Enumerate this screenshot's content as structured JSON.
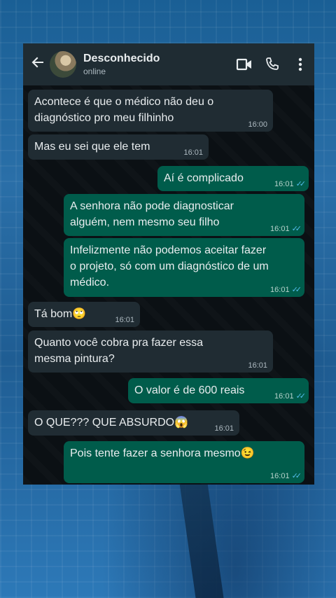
{
  "header": {
    "contact_name": "Desconhecido",
    "status": "online",
    "icons": [
      "back-arrow-icon",
      "avatar",
      "video-call-icon",
      "phone-call-icon",
      "more-options-icon"
    ]
  },
  "messages": [
    {
      "dir": "in",
      "text": "Acontece é que o médico não deu o diagnóstico pro meu filhinho",
      "time": "16:00"
    },
    {
      "dir": "in",
      "text": "Mas eu sei que ele tem",
      "time": "16:01"
    },
    {
      "dir": "out",
      "text": "Aí é complicado",
      "time": "16:01",
      "read": true
    },
    {
      "dir": "out",
      "text": "A senhora não pode diagnosticar alguém, nem mesmo seu filho",
      "time": "16:01",
      "read": true
    },
    {
      "dir": "out",
      "text": "Infelizmente não podemos aceitar fazer o projeto, só com um diagnóstico de um médico.",
      "time": "16:01",
      "read": true
    },
    {
      "dir": "in",
      "text": "Tá bom",
      "emoji": "🙄",
      "time": "16:01"
    },
    {
      "dir": "in",
      "text": "Quanto você cobra pra fazer essa mesma pintura?",
      "time": "16:01"
    },
    {
      "dir": "out",
      "text": "O valor é de 600 reais",
      "time": "16:01",
      "read": true
    },
    {
      "dir": "in",
      "text": "O QUE??? QUE ABSURDO",
      "emoji": "😱",
      "time": "16:01"
    },
    {
      "dir": "out",
      "text": "Pois tente fazer a senhora mesmo",
      "emoji": "😉",
      "time": "16:01",
      "read": true
    }
  ],
  "colors": {
    "header": "#1f2c33",
    "incoming": "#202c33",
    "outgoing": "#005c4b",
    "ticks": "#53bdeb"
  }
}
